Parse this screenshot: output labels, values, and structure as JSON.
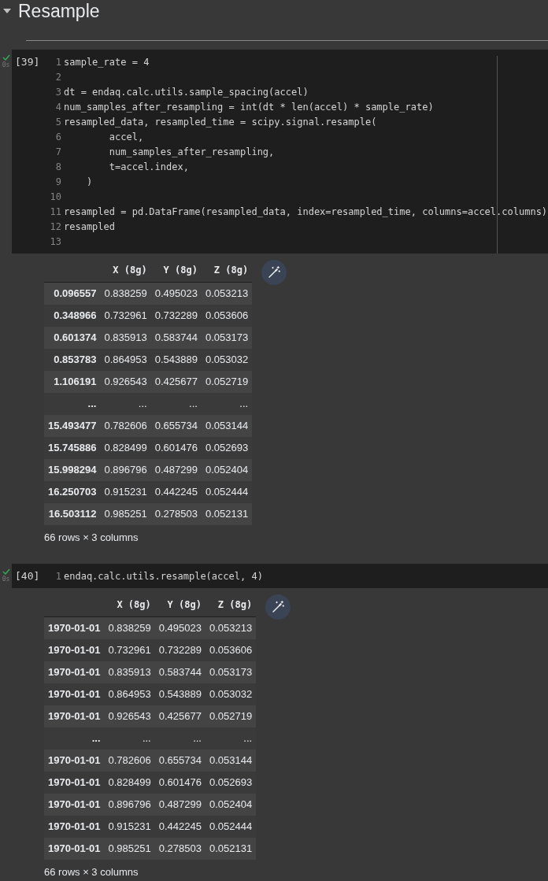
{
  "section": {
    "title": "Resample",
    "expanded": true
  },
  "cells": [
    {
      "execution_count": "[39]",
      "succeeded": true,
      "duration": "0s",
      "code": [
        {
          "number": "1",
          "text": "sample_rate = 4"
        },
        {
          "number": "2"
        },
        {
          "number": "3",
          "text": "dt = endaq.calc.utils.sample_spacing(accel)"
        },
        {
          "number": "4",
          "text": "num_samples_after_resampling = int(dt * len(accel) * sample_rate)"
        },
        {
          "number": "5",
          "text": "resampled_data, resampled_time = scipy.signal.resample("
        },
        {
          "number": "6",
          "text": "        accel,"
        },
        {
          "number": "7",
          "text": "        num_samples_after_resampling,"
        },
        {
          "number": "8",
          "text": "        t=accel.index,"
        },
        {
          "number": "9",
          "text": "    )"
        },
        {
          "number": "10"
        },
        {
          "number": "11",
          "text": "resampled = pd.DataFrame(resampled_data, index=resampled_time, columns=accel.columns)"
        },
        {
          "number": "12",
          "text": "resampled"
        },
        {
          "number": "13"
        }
      ],
      "output": {
        "columns": [
          "",
          "X (8g)",
          "Y (8g)",
          "Z (8g)"
        ],
        "rows": [
          [
            "0.096557",
            "0.838259",
            "0.495023",
            "0.053213"
          ],
          [
            "0.348966",
            "0.732961",
            "0.732289",
            "0.053606"
          ],
          [
            "0.601374",
            "0.835913",
            "0.583744",
            "0.053173"
          ],
          [
            "0.853783",
            "0.864953",
            "0.543889",
            "0.053032"
          ],
          [
            "1.106191",
            "0.926543",
            "0.425677",
            "0.052719"
          ],
          [
            "...",
            "...",
            "...",
            "..."
          ],
          [
            "15.493477",
            "0.782606",
            "0.655734",
            "0.053144"
          ],
          [
            "15.745886",
            "0.828499",
            "0.601476",
            "0.052693"
          ],
          [
            "15.998294",
            "0.896796",
            "0.487299",
            "0.052404"
          ],
          [
            "16.250703",
            "0.915231",
            "0.442245",
            "0.052444"
          ],
          [
            "16.503112",
            "0.985251",
            "0.278503",
            "0.052131"
          ]
        ],
        "shape": "66 rows × 3 columns"
      }
    },
    {
      "execution_count": "[40]",
      "succeeded": true,
      "duration": "0s",
      "code": [
        {
          "number": "1",
          "text": "endaq.calc.utils.resample(accel, 4)"
        }
      ],
      "output": {
        "columns": [
          "",
          "X (8g)",
          "Y (8g)",
          "Z (8g)"
        ],
        "rows": [
          [
            "1970-01-01",
            "0.838259",
            "0.495023",
            "0.053213"
          ],
          [
            "1970-01-01",
            "0.732961",
            "0.732289",
            "0.053606"
          ],
          [
            "1970-01-01",
            "0.835913",
            "0.583744",
            "0.053173"
          ],
          [
            "1970-01-01",
            "0.864953",
            "0.543889",
            "0.053032"
          ],
          [
            "1970-01-01",
            "0.926543",
            "0.425677",
            "0.052719"
          ],
          [
            "...",
            "...",
            "...",
            "..."
          ],
          [
            "1970-01-01",
            "0.782606",
            "0.655734",
            "0.053144"
          ],
          [
            "1970-01-01",
            "0.828499",
            "0.601476",
            "0.052693"
          ],
          [
            "1970-01-01",
            "0.896796",
            "0.487299",
            "0.052404"
          ],
          [
            "1970-01-01",
            "0.915231",
            "0.442245",
            "0.052444"
          ],
          [
            "1970-01-01",
            "0.985251",
            "0.278503",
            "0.052131"
          ]
        ],
        "shape": "66 rows × 3 columns"
      }
    }
  ]
}
